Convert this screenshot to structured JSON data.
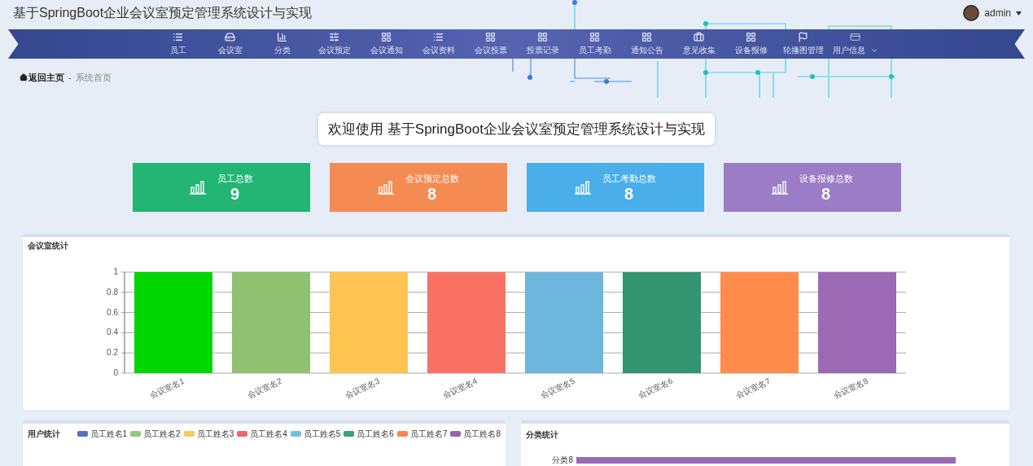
{
  "header": {
    "title": "基于SpringBoot企业会议室预定管理系统设计与实现",
    "user": "admin"
  },
  "nav": [
    {
      "label": "员工",
      "kind": "list",
      "dropdown": false
    },
    {
      "label": "会议室",
      "kind": "drive",
      "dropdown": false
    },
    {
      "label": "分类",
      "kind": "bars",
      "dropdown": false
    },
    {
      "label": "会议预定",
      "kind": "sliders",
      "dropdown": false
    },
    {
      "label": "会议通知",
      "kind": "grid",
      "dropdown": false
    },
    {
      "label": "会议资料",
      "kind": "list",
      "dropdown": false
    },
    {
      "label": "会议投票",
      "kind": "grid",
      "dropdown": false
    },
    {
      "label": "投票记录",
      "kind": "grid",
      "dropdown": false
    },
    {
      "label": "员工考勤",
      "kind": "grid",
      "dropdown": false
    },
    {
      "label": "通知公告",
      "kind": "grid",
      "dropdown": false
    },
    {
      "label": "意见收集",
      "kind": "briefcase",
      "dropdown": false
    },
    {
      "label": "设备报修",
      "kind": "grid",
      "dropdown": false
    },
    {
      "label": "轮播图管理",
      "kind": "flag",
      "dropdown": false
    },
    {
      "label": "用户信息",
      "kind": "card",
      "dropdown": true
    }
  ],
  "breadcrumb": {
    "home": "返回主页",
    "separator": "-",
    "current": "系统首页"
  },
  "welcome": "欢迎使用 基于SpringBoot企业会议室预定管理系统设计与实现",
  "stats": [
    {
      "label": "员工总数",
      "value": "9",
      "color": "#22b573"
    },
    {
      "label": "会议预定总数",
      "value": "8",
      "color": "#f38b52"
    },
    {
      "label": "员工考勤总数",
      "value": "8",
      "color": "#4aaee8"
    },
    {
      "label": "设备报修总数",
      "value": "8",
      "color": "#9b7cc6"
    }
  ],
  "room_chart": {
    "title": "会议室统计",
    "chart_data": {
      "type": "bar",
      "categories": [
        "会议室名1",
        "会议室名2",
        "会议室名3",
        "会议室名4",
        "会议室名5",
        "会议室名6",
        "会议室名7",
        "会议室名8"
      ],
      "series": [
        {
          "values": [
            1,
            1,
            1,
            1,
            1,
            1,
            1,
            1
          ]
        }
      ],
      "grid": true,
      "colors": [
        "#00d600",
        "#8fc171",
        "#ffc452",
        "#f87163",
        "#6db6dd",
        "#329470",
        "#ff8b4c",
        "#9c69b5"
      ],
      "ylim": [
        0,
        1
      ],
      "yticks": [
        0,
        0.2,
        0.4,
        0.6,
        0.8,
        1
      ]
    }
  },
  "user_chart": {
    "title": "用户统计",
    "legend": [
      {
        "name": "员工姓名1",
        "color": "#5470c6"
      },
      {
        "name": "员工姓名2",
        "color": "#91cc75"
      },
      {
        "name": "员工姓名3",
        "color": "#fac858"
      },
      {
        "name": "员工姓名4",
        "color": "#ee6666"
      },
      {
        "name": "员工姓名5",
        "color": "#73c0de"
      },
      {
        "name": "员工姓名6",
        "color": "#3ba272"
      },
      {
        "name": "员工姓名7",
        "color": "#fc8452"
      },
      {
        "name": "员工姓名8",
        "color": "#9a60b4"
      }
    ]
  },
  "category_chart": {
    "title": "分类统计",
    "axis_label": "分类8"
  }
}
